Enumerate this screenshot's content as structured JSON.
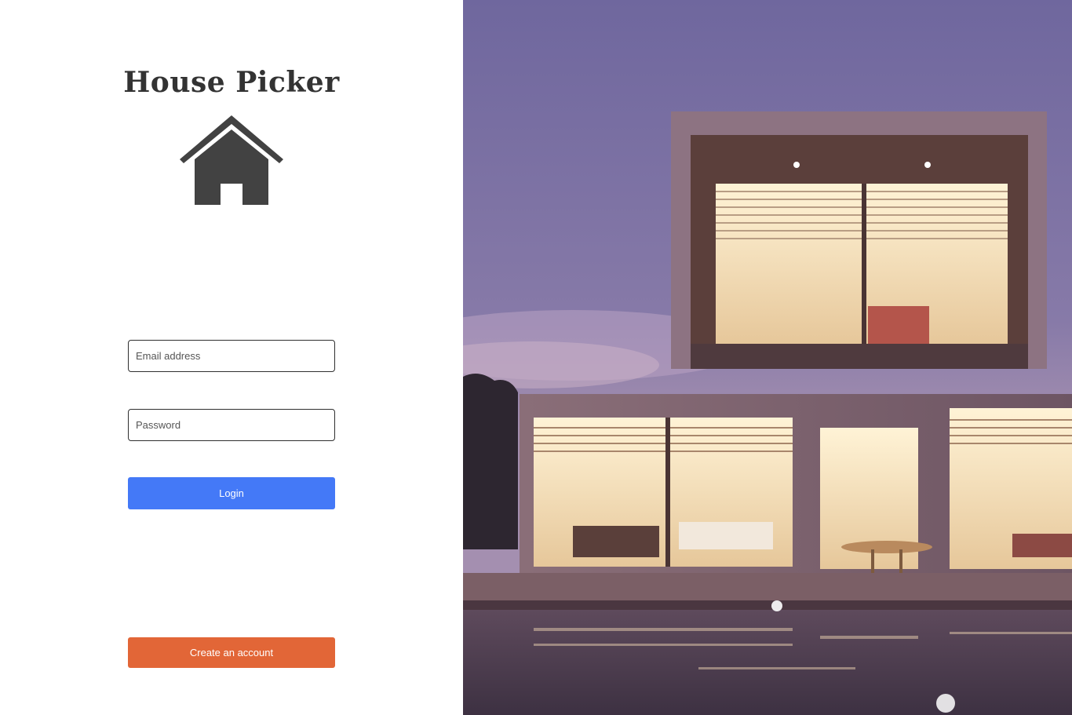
{
  "app": {
    "title": "House Picker",
    "logo_icon": "house-icon"
  },
  "login_form": {
    "email": {
      "placeholder": "Email address",
      "value": ""
    },
    "password": {
      "placeholder": "Password",
      "value": ""
    },
    "login_label": "Login"
  },
  "signup": {
    "create_account_label": "Create an account"
  },
  "colors": {
    "login_button": "#4479f7",
    "create_button": "#e26637",
    "logo": "#424242",
    "title": "#333333"
  },
  "hero": {
    "image_icon": "modern-house-photo"
  }
}
